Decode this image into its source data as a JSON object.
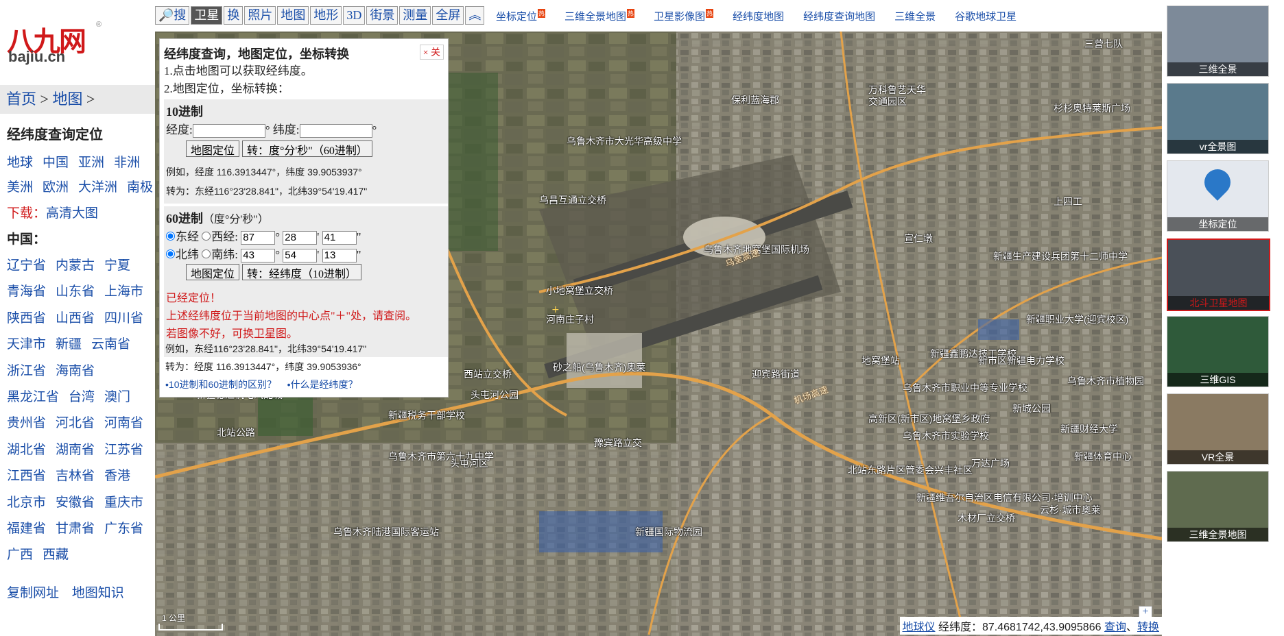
{
  "logo": {
    "mark": "八九网",
    "reg": "®",
    "domain": "bajiu.cn"
  },
  "breadcrumb": {
    "home": "首页",
    "sep1": " > ",
    "map": "地图",
    "sep2": " >"
  },
  "left": {
    "title": "经纬度查询定位",
    "rows": [
      [
        "地球",
        "中国",
        "亚洲",
        "非洲"
      ],
      [
        "美洲",
        "欧洲",
        "大洋洲",
        "南极"
      ]
    ],
    "download_label": "下载：",
    "download_link": "高清大图",
    "china_label": "中国：",
    "provinces": [
      [
        "辽宁省",
        "内蒙古",
        "宁夏"
      ],
      [
        "青海省",
        "山东省",
        "上海市"
      ],
      [
        "陕西省",
        "山西省",
        "四川省"
      ],
      [
        "天津市",
        "新疆",
        "云南省"
      ],
      [
        "浙江省",
        "海南省"
      ],
      [
        "黑龙江省",
        "台湾",
        "澳门"
      ],
      [
        "贵州省",
        "河北省",
        "河南省"
      ],
      [
        "湖北省",
        "湖南省",
        "江苏省"
      ],
      [
        "江西省",
        "吉林省",
        "香港"
      ],
      [
        "北京市",
        "安徽省",
        "重庆市"
      ],
      [
        "福建省",
        "甘肃省",
        "广东省"
      ],
      [
        "广西",
        "西藏"
      ]
    ],
    "footer_links": [
      "复制网址",
      "地图知识"
    ]
  },
  "toolbar": {
    "buttons": [
      "搜",
      "卫星",
      "换",
      "照片",
      "地图",
      "地形",
      "3D",
      "街景",
      "测量",
      "全屏",
      "︽"
    ],
    "active_index": 1
  },
  "toplinks": [
    {
      "label": "坐标定位",
      "hot": "热"
    },
    {
      "label": "三维全景地图",
      "hot": "热"
    },
    {
      "label": "卫星影像图",
      "hot": "热"
    },
    {
      "label": "经纬度地图",
      "hot": ""
    },
    {
      "label": "经纬度查询地图",
      "hot": ""
    },
    {
      "label": "三维全景",
      "hot": ""
    },
    {
      "label": "谷歌地球卫星",
      "hot": ""
    }
  ],
  "panel": {
    "title": "经纬度查询，地图定位，坐标转换",
    "close": "× 关",
    "intro1": "1.点击地图可以获取经纬度。",
    "intro2": "2.地图定位，坐标转换：",
    "dec_title": "10进制",
    "lng_label": "经度:",
    "lat_label": "纬度:",
    "deg": "°",
    "locate_btn": "地图定位",
    "convert_dms_btn": "转：度°分'秒\"（60进制）",
    "example1": "例如，经度 116.3913447°，纬度 39.9053937°",
    "convert1": "转为：东经116°23'28.841\"，北纬39°54'19.417\"",
    "dms_title": "60进制",
    "dms_sub": "（度°分'秒\"）",
    "east": "东经",
    "west": "西经:",
    "north": "北纬",
    "south": "南纬:",
    "lng_d": "87",
    "lng_m": "28",
    "lng_s": "41",
    "lat_d": "43",
    "lat_m": "54",
    "lat_s": "13",
    "min": "'",
    "sec": "\"",
    "convert_dec_btn": "转：经纬度（10进制）",
    "status1": "已经定位！",
    "status2": "上述经纬度位于当前地图的中心点\"＋\"处，请查阅。",
    "status3": "若图像不好，可换卫星图。",
    "example2": "例如，东经116°23'28.841\"，北纬39°54'19.417\"",
    "convert2": "转为：经度 116.3913447°，纬度 39.9053936°",
    "link1": "•10进制和60进制的区别？",
    "link2": "•什么是经纬度？"
  },
  "map_labels": [
    "保利蓝海郡",
    "万科鲁艺天华",
    "交通园区",
    "三营七队",
    "杉杉奥特莱斯广场",
    "乌鲁木齐市大光华高级中学",
    "乌昌互通立交桥",
    "上四工",
    "宣仁墩",
    "新疆生产建设兵团第十二师中学",
    "乌鲁木齐地窝堡国际机场",
    "小地窝堡立交桥",
    "河南庄子村",
    "新疆职业大学(迎宾校区)",
    "新疆鑫鹏达技工学校",
    "地窝堡站",
    "新市区新疆电力学校",
    "砂之船(乌鲁木齐)奥莱",
    "西站立交桥",
    "迎宾路街道",
    "乌鲁木齐市职业中等专业学校",
    "新疆德汇机电汽配城",
    "头屯河公园",
    "新疆税务干部学校",
    "高新区(新市区)地窝堡乡政府",
    "乌鲁木齐市实验学校",
    "新城公园",
    "新疆财经大学",
    "乌鲁木齐市植物园",
    "乌鲁木齐市第六十九中学",
    "头屯河区",
    "豫宾路立交",
    "北站东路片区管委会兴丰社区",
    "万达广场",
    "新疆体育中心",
    "新疆维吾尔自治区电信有限公司·培训中心",
    "云杉·城市奥莱",
    "木材厂立交桥",
    "乌鲁木齐陆港国际客运站",
    "新疆国际物流园",
    "北站公路",
    "机场高速",
    "乌奎高速"
  ],
  "right_thumbs": [
    {
      "label": "三维全景",
      "color": "#7d8a99"
    },
    {
      "label": "vr全景图",
      "color": "#5a7a8c"
    },
    {
      "label": "坐标定位",
      "color": "#e4e8ee"
    },
    {
      "label": "北斗卫星地图",
      "color": "#4a5058"
    },
    {
      "label": "三维GIS",
      "color": "#2f5a3a"
    },
    {
      "label": "VR全景",
      "color": "#8a7a62"
    },
    {
      "label": "三维全景地图",
      "color": "#5f6b4f"
    }
  ],
  "coordbar": {
    "globe": "地球仪",
    "label": "经纬度：",
    "value": "87.4681742,43.9095866",
    "query": "查询",
    "sep": "、",
    "convert": "转换"
  },
  "scale": "1 公里",
  "zoom": {
    "plus": "+",
    "minus": "−"
  }
}
